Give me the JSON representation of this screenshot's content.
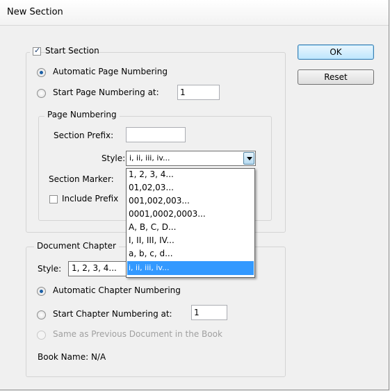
{
  "window": {
    "title": "New Section"
  },
  "buttons": {
    "ok": "OK",
    "reset": "Reset"
  },
  "start_section": {
    "label": "Start Section",
    "checked": true
  },
  "page_numbering_mode": {
    "automatic": "Automatic Page Numbering",
    "start_at": "Start Page Numbering at:",
    "start_value": "1"
  },
  "page_numbering": {
    "legend": "Page Numbering",
    "prefix_label": "Section Prefix:",
    "prefix_value": "",
    "style_label": "Style:",
    "style_value": "i, ii, iii, iv...",
    "marker_label": "Section Marker:",
    "include_prefix_label": "Include Prefix"
  },
  "style_options": [
    "1, 2, 3, 4...",
    "01,02,03...",
    "001,002,003...",
    "0001,0002,0003...",
    "A, B, C, D...",
    "I, II, III, IV...",
    "a, b, c, d...",
    "i, ii, iii, iv..."
  ],
  "document_chapter": {
    "legend": "Document Chapter",
    "style_label": "Style:",
    "style_value": "1, 2, 3, 4...",
    "automatic": "Automatic Chapter Numbering",
    "start_at": "Start Chapter Numbering at:",
    "start_value": "1",
    "same_as_previous": "Same as Previous Document in the Book",
    "book_name": "Book Name: N/A"
  },
  "colors": {
    "selection": "#3399ff",
    "accent": "#1b5fa5"
  }
}
